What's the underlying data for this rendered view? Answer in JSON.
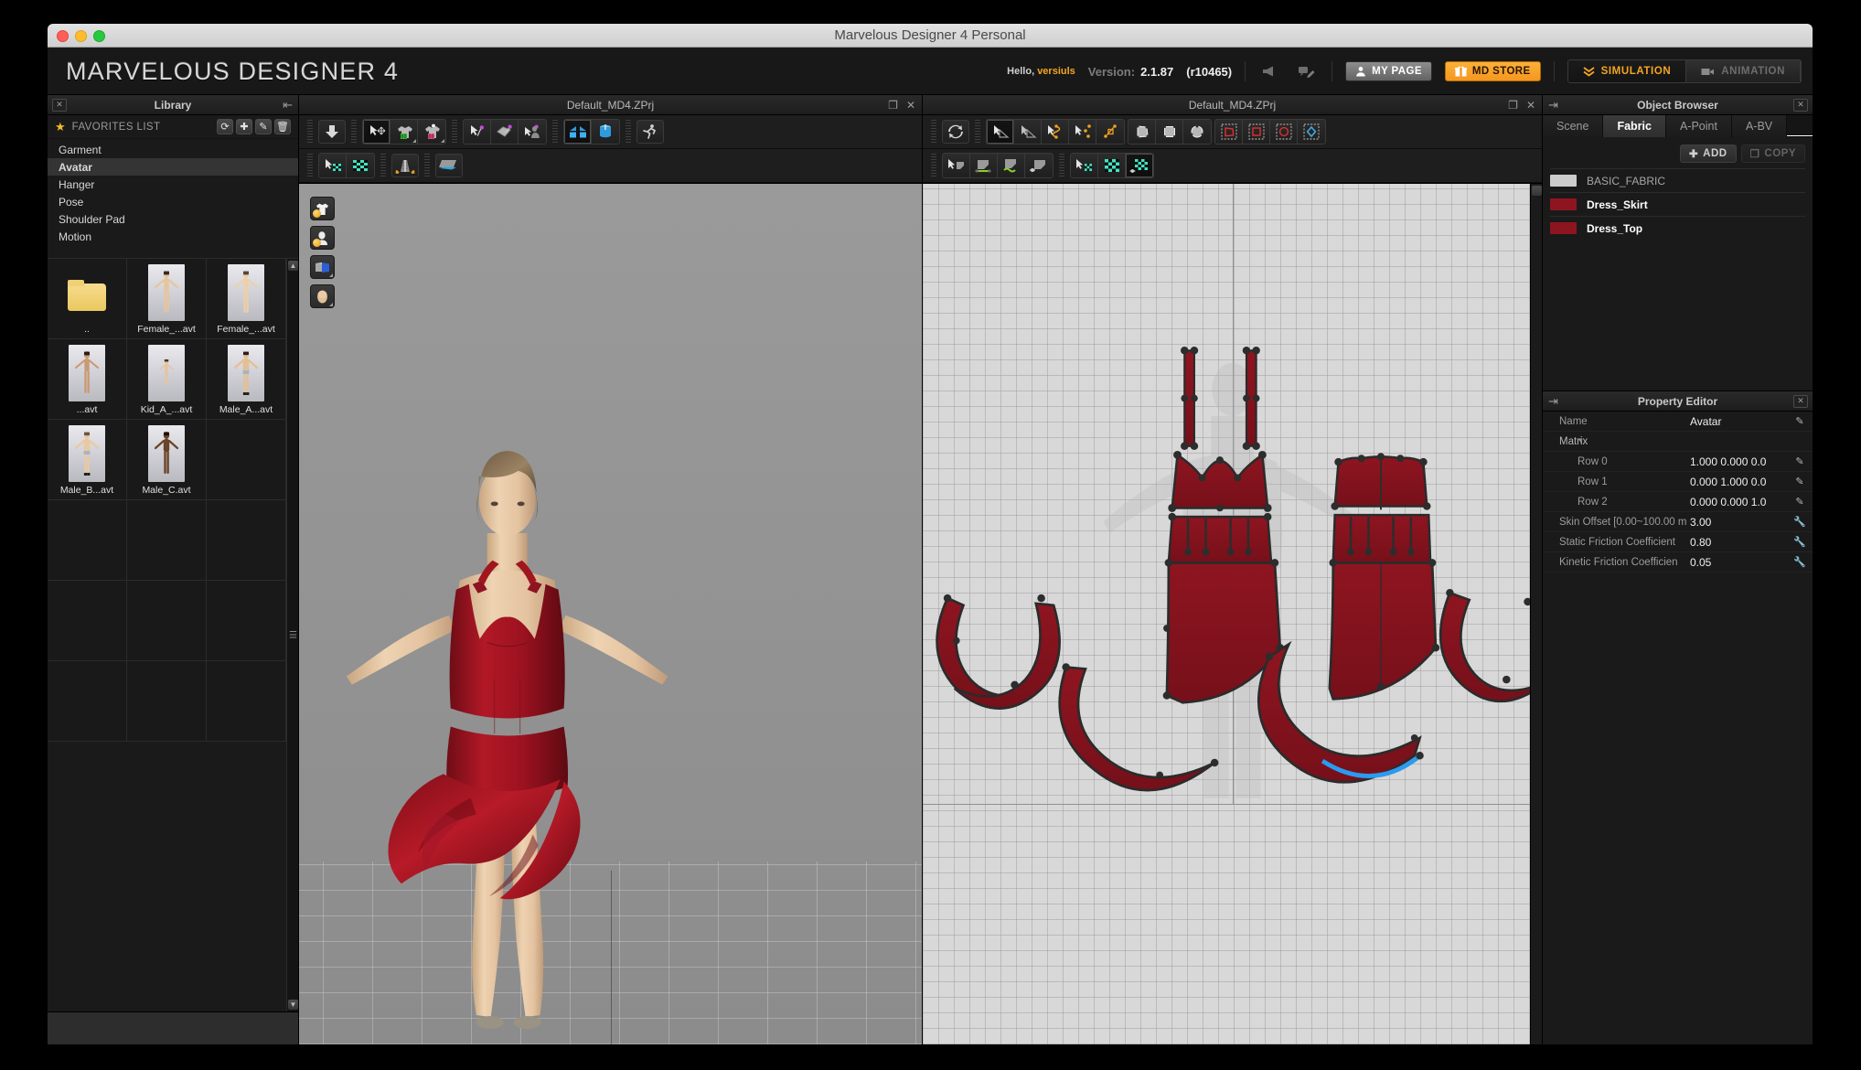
{
  "window": {
    "title": "Marvelous Designer 4 Personal"
  },
  "header": {
    "brand": "MARVELOUS DESIGNER 4",
    "hello_prefix": "Hello,",
    "username": "versiuls",
    "version_label": "Version:",
    "version_number": "2.1.87",
    "revision": "(r10465)",
    "my_page": "MY PAGE",
    "md_store": "MD STORE",
    "modes": [
      {
        "label": "SIMULATION",
        "active": true
      },
      {
        "label": "ANIMATION",
        "active": false
      }
    ],
    "accent": "#f5a623"
  },
  "library": {
    "title": "Library",
    "favorites_label": "FAVORITES LIST",
    "mini_buttons": [
      "refresh-icon",
      "add-icon",
      "edit-icon",
      "delete-icon"
    ],
    "items": [
      {
        "label": "Garment",
        "active": false
      },
      {
        "label": "Avatar",
        "active": true
      },
      {
        "label": "Hanger",
        "active": false
      },
      {
        "label": "Pose",
        "active": false
      },
      {
        "label": "Shoulder Pad",
        "active": false
      },
      {
        "label": "Motion",
        "active": false
      }
    ],
    "files": [
      {
        "name": "..",
        "type": "folder"
      },
      {
        "name": "Female_...avt",
        "type": "avatar",
        "tone": "#e8c49c",
        "hair": "#3a2a1e"
      },
      {
        "name": "Female_...avt",
        "type": "avatar",
        "tone": "#edcfa8",
        "hair": "#5a4634"
      },
      {
        "name": "...avt",
        "type": "avatar",
        "tone": "#c99a72",
        "hair": "#2b1d14"
      },
      {
        "name": "Kid_A_...avt",
        "type": "avatar",
        "tone": "#e7c49e",
        "hair": "#4a3526"
      },
      {
        "name": "Male_A...avt",
        "type": "avatar",
        "tone": "#e3c094",
        "hair": "#2e2018"
      },
      {
        "name": "Male_B...avt",
        "type": "avatar",
        "tone": "#e9c9a4",
        "hair": "#6b5540"
      },
      {
        "name": "Male_C.avt",
        "type": "avatar",
        "tone": "#6b4328",
        "hair": "#1a110b"
      },
      {
        "name": "",
        "type": "empty"
      }
    ]
  },
  "viewport3d": {
    "title": "Default_MD4.ZPrj",
    "toolbar_row1": [
      "gravity-drop-icon",
      "select-move-garment-icon",
      "select-mesh-green-icon",
      "select-mesh-pink-icon",
      "select-pin-icon",
      "box-pin-icon",
      "avatar-pin-icon",
      "fold-arrange-icon",
      "arrange-cylinder-icon",
      "run-simulation-icon"
    ],
    "toolbar_row2": [
      "select-texture-icon",
      "texture-edit-icon",
      "zipper-icon",
      "fabric-plane-icon"
    ],
    "side_icons": [
      "show-garment-icon",
      "show-avatar-icon",
      "show-fabric-icon",
      "show-skin-icon"
    ]
  },
  "viewport2d": {
    "title": "Default_MD4.ZPrj",
    "header_icons": [
      "restore-icon",
      "close-icon"
    ],
    "toolbar_row1": [
      "sync-icon",
      "edit-pattern-icon",
      "edit-curve-point-icon",
      "edit-curvature-icon",
      "add-point-icon",
      "fold-arrange-2d-icon",
      "polygon-icon",
      "rectangle-icon",
      "circle-icon",
      "internal-polygon-icon",
      "internal-rectangle-icon",
      "internal-circle-icon",
      "dart-icon"
    ],
    "toolbar_row2": [
      "select-sewing-icon",
      "segment-sewing-icon",
      "free-sewing-icon",
      "sewing-edit-icon",
      "select-texture-2d-icon",
      "texture-2d-icon",
      "texture-edit-2d-icon"
    ]
  },
  "object_browser": {
    "title": "Object Browser",
    "tabs": [
      {
        "label": "Scene",
        "active": false
      },
      {
        "label": "Fabric",
        "active": true
      },
      {
        "label": "A-Point",
        "active": false
      },
      {
        "label": "A-BV",
        "active": false
      }
    ],
    "add_label": "ADD",
    "copy_label": "COPY",
    "fabrics": [
      {
        "name": "BASIC_FABRIC",
        "color": "#cccccc",
        "selected": false
      },
      {
        "name": "Dress_Skirt",
        "color": "#8e1520",
        "selected": true
      },
      {
        "name": "Dress_Top",
        "color": "#8e1520",
        "selected": true
      }
    ]
  },
  "property_editor": {
    "title": "Property Editor",
    "rows": [
      {
        "label": "Name",
        "value": "Avatar",
        "icon": "pencil-icon",
        "indent": 0
      },
      {
        "label": "Matrix",
        "value": "",
        "icon": "",
        "indent": 0,
        "group": true
      },
      {
        "label": "Row 0",
        "value": "1.000 0.000 0.0",
        "icon": "pencil-icon",
        "indent": 1
      },
      {
        "label": "Row 1",
        "value": "0.000 1.000 0.0",
        "icon": "pencil-icon",
        "indent": 1
      },
      {
        "label": "Row 2",
        "value": "0.000 0.000 1.0",
        "icon": "pencil-icon",
        "indent": 1
      },
      {
        "label": "Skin Offset [0.00~100.00 m",
        "value": "3.00",
        "icon": "wrench-icon",
        "indent": 0
      },
      {
        "label": "Static Friction Coefficient",
        "value": "0.80",
        "icon": "wrench-icon",
        "indent": 0
      },
      {
        "label": "Kinetic Friction Coefficien",
        "value": "0.05",
        "icon": "wrench-icon",
        "indent": 0
      }
    ]
  },
  "colors": {
    "dress_red": "#8e1520",
    "accent_orange": "#f5a623",
    "panel_bg": "#1a1a1a",
    "viewport_2d_bg": "#d8d8d8"
  }
}
